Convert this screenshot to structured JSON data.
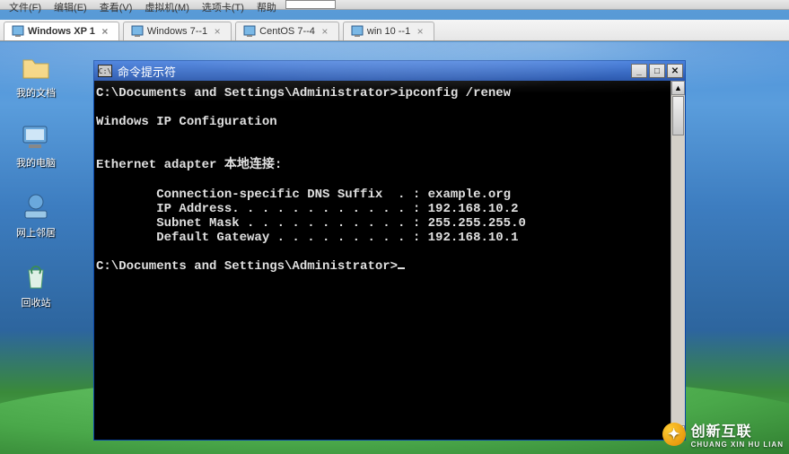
{
  "menubar": {
    "items": [
      "文件(F)",
      "编辑(E)",
      "查看(V)",
      "虚拟机(M)",
      "选项卡(T)",
      "帮助"
    ]
  },
  "tabs": [
    {
      "label": "Windows XP 1",
      "active": true
    },
    {
      "label": "Windows 7--1",
      "active": false
    },
    {
      "label": "CentOS 7--4",
      "active": false
    },
    {
      "label": "win 10 --1",
      "active": false
    }
  ],
  "desktop_icons": [
    {
      "label": "我的文档",
      "name": "my-documents"
    },
    {
      "label": "我的电脑",
      "name": "my-computer"
    },
    {
      "label": "网上邻居",
      "name": "network-places"
    },
    {
      "label": "回收站",
      "name": "recycle-bin"
    }
  ],
  "cmd": {
    "title": "命令提示符",
    "prompt1": "C:\\Documents and Settings\\Administrator>",
    "command": "ipconfig /renew",
    "heading": "Windows IP Configuration",
    "adapter_line": "Ethernet adapter 本地连接:",
    "dns_suffix_line": "        Connection-specific DNS Suffix  . : example.org",
    "ip_line": "        IP Address. . . . . . . . . . . . : 192.168.10.2",
    "mask_line": "        Subnet Mask . . . . . . . . . . . : 255.255.255.0",
    "gw_line": "        Default Gateway . . . . . . . . . : 192.168.10.1",
    "prompt2": "C:\\Documents and Settings\\Administrator>"
  },
  "minimize": "_",
  "maximize": "□",
  "close": "✕",
  "app_icon_text": "C:\\",
  "watermark": {
    "main": "创新互联",
    "sub": "CHUANG XIN HU LIAN"
  }
}
